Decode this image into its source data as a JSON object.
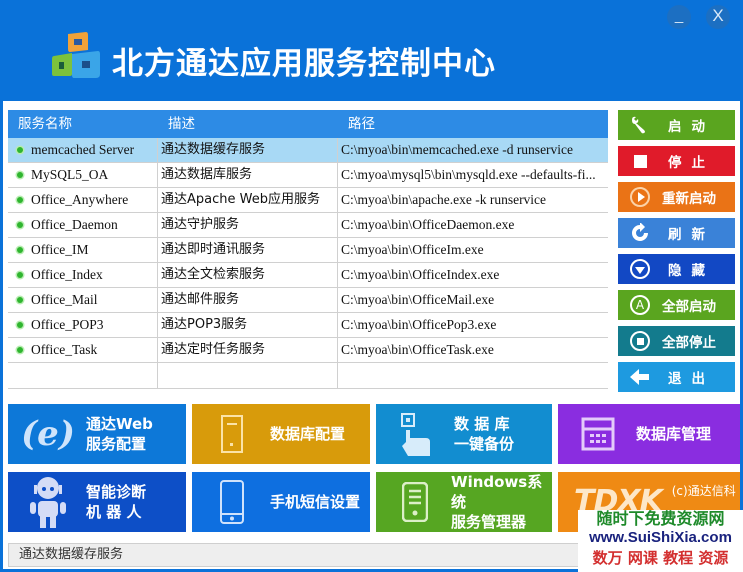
{
  "window": {
    "title": "北方通达应用服务控制中心",
    "minimize_label": "_",
    "close_label": "X"
  },
  "table": {
    "columns": [
      "服务名称",
      "描述",
      "路径"
    ],
    "rows": [
      {
        "name": "memcached Server",
        "desc": "通达数据缓存服务",
        "path": "C:\\myoa\\bin\\memcached.exe -d runservice",
        "selected": true
      },
      {
        "name": "MySQL5_OA",
        "desc": "通达数据库服务",
        "path": "C:\\myoa\\mysql5\\bin\\mysqld.exe --defaults-fi..."
      },
      {
        "name": "Office_Anywhere",
        "desc": "通达Apache Web应用服务",
        "path": "C:\\myoa\\bin\\apache.exe -k runservice"
      },
      {
        "name": "Office_Daemon",
        "desc": "通达守护服务",
        "path": "C:\\myoa\\bin\\OfficeDaemon.exe"
      },
      {
        "name": "Office_IM",
        "desc": "通达即时通讯服务",
        "path": "C:\\myoa\\bin\\OfficeIm.exe"
      },
      {
        "name": "Office_Index",
        "desc": "通达全文检索服务",
        "path": "C:\\myoa\\bin\\OfficeIndex.exe"
      },
      {
        "name": "Office_Mail",
        "desc": "通达邮件服务",
        "path": "C:\\myoa\\bin\\OfficeMail.exe"
      },
      {
        "name": "Office_POP3",
        "desc": "通达POP3服务",
        "path": "C:\\myoa\\bin\\OfficePop3.exe"
      },
      {
        "name": "Office_Task",
        "desc": "通达定时任务服务",
        "path": "C:\\myoa\\bin\\OfficeTask.exe"
      }
    ]
  },
  "actions": [
    {
      "id": "start",
      "label": "启动",
      "icon": "wrench-icon",
      "color": "#5aa51f"
    },
    {
      "id": "stop",
      "label": "停止",
      "icon": "stop-square-icon",
      "color": "#e01b2a"
    },
    {
      "id": "restart",
      "label": "重新启动",
      "icon": "play-circle-icon",
      "color": "#ea7316"
    },
    {
      "id": "refresh",
      "label": "刷新",
      "icon": "refresh-icon",
      "color": "#3a82d8"
    },
    {
      "id": "hide",
      "label": "隐藏",
      "icon": "down-circle-icon",
      "color": "#1248c4"
    },
    {
      "id": "start-all",
      "label": "全部启动",
      "icon": "a-circle-icon",
      "color": "#5aa51f"
    },
    {
      "id": "stop-all",
      "label": "全部停止",
      "icon": "stop-circle-icon",
      "color": "#137b8d"
    },
    {
      "id": "exit",
      "label": "退出",
      "icon": "arrow-left-icon",
      "color": "#1e9ae0"
    }
  ],
  "tiles": [
    {
      "id": "web-config",
      "line1": "通达Web",
      "line2": "服务配置",
      "icon": "ie-icon",
      "color": "#0d78d8"
    },
    {
      "id": "db-config",
      "line1": "数据库配置",
      "line2": "",
      "icon": "server-icon",
      "color": "#d89b0b"
    },
    {
      "id": "db-backup",
      "line1": "数 据 库",
      "line2": "一键备份",
      "icon": "touch-icon",
      "color": "#128dd0"
    },
    {
      "id": "db-manage",
      "line1": "数据库管理",
      "line2": "",
      "icon": "calculator-icon",
      "color": "#8a2de0"
    },
    {
      "id": "diagnose",
      "line1": "智能诊断",
      "line2": "机 器 人",
      "icon": "robot-icon",
      "color": "#0d4fc7"
    },
    {
      "id": "sms-config",
      "line1": "手机短信设置",
      "line2": "",
      "icon": "phone-icon",
      "color": "#0e6fe0"
    },
    {
      "id": "win-services",
      "line1": "Windows系统",
      "line2": "服务管理器",
      "icon": "device-icon",
      "color": "#56a622"
    },
    {
      "id": "brand",
      "line1": "TDXK",
      "line2": "(c)通达信科",
      "icon": "",
      "color": "#ef8a14"
    }
  ],
  "statusbar": {
    "text": "通达数据缓存服务"
  },
  "watermark": {
    "line1": "随时下免费资源网",
    "line2": "www.SuiShiXia.com",
    "line3": "数万 网课 教程 资源"
  }
}
